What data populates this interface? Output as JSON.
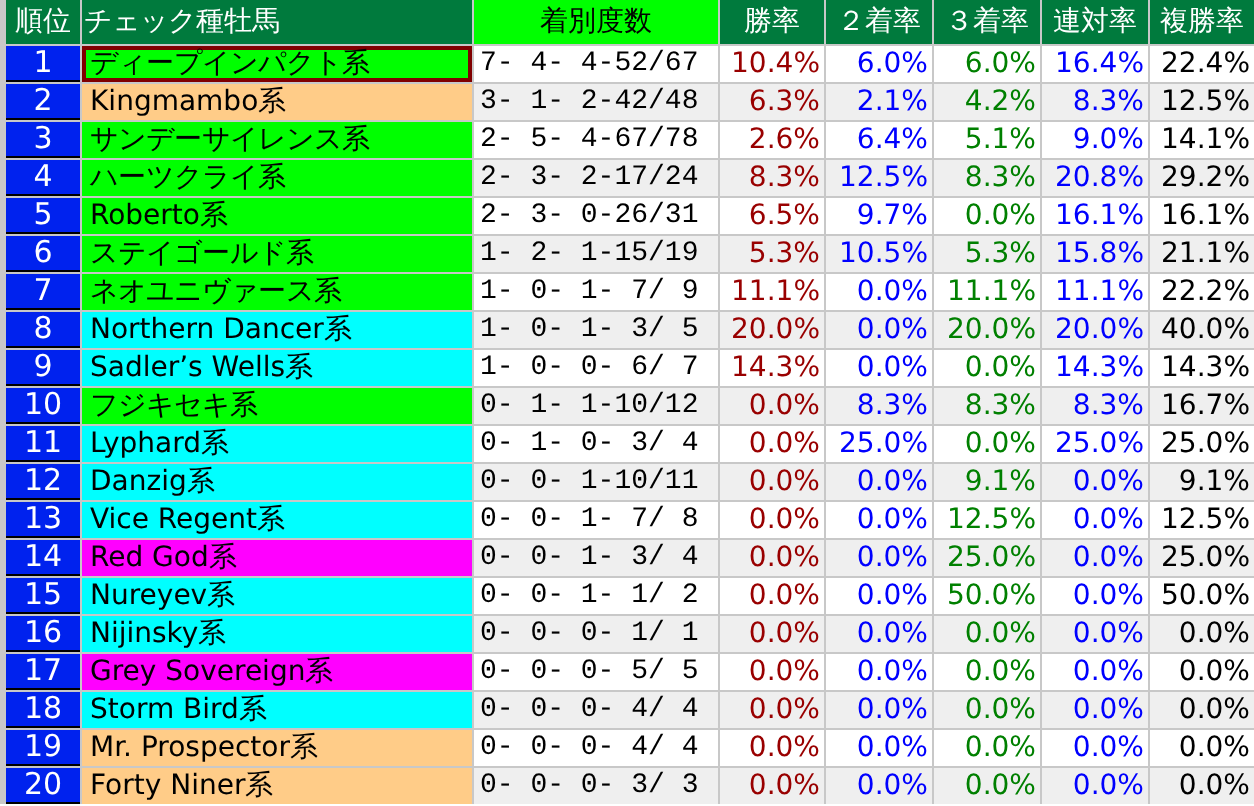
{
  "table": {
    "columns": [
      {
        "label": "順位",
        "selected": false
      },
      {
        "label": "チェック種牡馬",
        "selected": false
      },
      {
        "label": "着別度数",
        "selected": true
      },
      {
        "label": "勝率",
        "selected": false
      },
      {
        "label": "２着率",
        "selected": false
      },
      {
        "label": "３着率",
        "selected": false
      },
      {
        "label": "連対率",
        "selected": false
      },
      {
        "label": "複勝率",
        "selected": false
      }
    ],
    "rows": [
      {
        "rank": "1",
        "name": "ディープインパクト系",
        "color": "#00ff00",
        "selected": true,
        "record": "7- 4- 4-52/67",
        "rates": [
          "10.4%",
          "6.0%",
          "6.0%",
          "16.4%",
          "22.4%"
        ]
      },
      {
        "rank": "2",
        "name": "Kingmambo系",
        "color": "#ffcc88",
        "selected": false,
        "record": "3- 1- 2-42/48",
        "rates": [
          "6.3%",
          "2.1%",
          "4.2%",
          "8.3%",
          "12.5%"
        ]
      },
      {
        "rank": "3",
        "name": "サンデーサイレンス系",
        "color": "#00ff00",
        "selected": false,
        "record": "2- 5- 4-67/78",
        "rates": [
          "2.6%",
          "6.4%",
          "5.1%",
          "9.0%",
          "14.1%"
        ]
      },
      {
        "rank": "4",
        "name": "ハーツクライ系",
        "color": "#00ff00",
        "selected": false,
        "record": "2- 3- 2-17/24",
        "rates": [
          "8.3%",
          "12.5%",
          "8.3%",
          "20.8%",
          "29.2%"
        ]
      },
      {
        "rank": "5",
        "name": "Roberto系",
        "color": "#00ff00",
        "selected": false,
        "record": "2- 3- 0-26/31",
        "rates": [
          "6.5%",
          "9.7%",
          "0.0%",
          "16.1%",
          "16.1%"
        ]
      },
      {
        "rank": "6",
        "name": "ステイゴールド系",
        "color": "#00ff00",
        "selected": false,
        "record": "1- 2- 1-15/19",
        "rates": [
          "5.3%",
          "10.5%",
          "5.3%",
          "15.8%",
          "21.1%"
        ]
      },
      {
        "rank": "7",
        "name": "ネオユニヴァース系",
        "color": "#00ff00",
        "selected": false,
        "record": "1- 0- 1- 7/ 9",
        "rates": [
          "11.1%",
          "0.0%",
          "11.1%",
          "11.1%",
          "22.2%"
        ]
      },
      {
        "rank": "8",
        "name": "Northern Dancer系",
        "color": "#00ffff",
        "selected": false,
        "record": "1- 0- 1- 3/ 5",
        "rates": [
          "20.0%",
          "0.0%",
          "20.0%",
          "20.0%",
          "40.0%"
        ]
      },
      {
        "rank": "9",
        "name": "Sadler’s Wells系",
        "color": "#00ffff",
        "selected": false,
        "record": "1- 0- 0- 6/ 7",
        "rates": [
          "14.3%",
          "0.0%",
          "0.0%",
          "14.3%",
          "14.3%"
        ]
      },
      {
        "rank": "10",
        "name": "フジキセキ系",
        "color": "#00ff00",
        "selected": false,
        "record": "0- 1- 1-10/12",
        "rates": [
          "0.0%",
          "8.3%",
          "8.3%",
          "8.3%",
          "16.7%"
        ]
      },
      {
        "rank": "11",
        "name": "Lyphard系",
        "color": "#00ffff",
        "selected": false,
        "record": "0- 1- 0- 3/ 4",
        "rates": [
          "0.0%",
          "25.0%",
          "0.0%",
          "25.0%",
          "25.0%"
        ]
      },
      {
        "rank": "12",
        "name": "Danzig系",
        "color": "#00ffff",
        "selected": false,
        "record": "0- 0- 1-10/11",
        "rates": [
          "0.0%",
          "0.0%",
          "9.1%",
          "0.0%",
          "9.1%"
        ]
      },
      {
        "rank": "13",
        "name": "Vice Regent系",
        "color": "#00ffff",
        "selected": false,
        "record": "0- 0- 1- 7/ 8",
        "rates": [
          "0.0%",
          "0.0%",
          "12.5%",
          "0.0%",
          "12.5%"
        ]
      },
      {
        "rank": "14",
        "name": "Red God系",
        "color": "#ff00ff",
        "selected": false,
        "record": "0- 0- 1- 3/ 4",
        "rates": [
          "0.0%",
          "0.0%",
          "25.0%",
          "0.0%",
          "25.0%"
        ]
      },
      {
        "rank": "15",
        "name": "Nureyev系",
        "color": "#00ffff",
        "selected": false,
        "record": "0- 0- 1- 1/ 2",
        "rates": [
          "0.0%",
          "0.0%",
          "50.0%",
          "0.0%",
          "50.0%"
        ]
      },
      {
        "rank": "16",
        "name": "Nijinsky系",
        "color": "#00ffff",
        "selected": false,
        "record": "0- 0- 0- 1/ 1",
        "rates": [
          "0.0%",
          "0.0%",
          "0.0%",
          "0.0%",
          "0.0%"
        ]
      },
      {
        "rank": "17",
        "name": "Grey Sovereign系",
        "color": "#ff00ff",
        "selected": false,
        "record": "0- 0- 0- 5/ 5",
        "rates": [
          "0.0%",
          "0.0%",
          "0.0%",
          "0.0%",
          "0.0%"
        ]
      },
      {
        "rank": "18",
        "name": "Storm Bird系",
        "color": "#00ffff",
        "selected": false,
        "record": "0- 0- 0- 4/ 4",
        "rates": [
          "0.0%",
          "0.0%",
          "0.0%",
          "0.0%",
          "0.0%"
        ]
      },
      {
        "rank": "19",
        "name": "Mr. Prospector系",
        "color": "#ffcc88",
        "selected": false,
        "record": "0- 0- 0- 4/ 4",
        "rates": [
          "0.0%",
          "0.0%",
          "0.0%",
          "0.0%",
          "0.0%"
        ]
      },
      {
        "rank": "20",
        "name": "Forty Niner系",
        "color": "#ffcc88",
        "selected": false,
        "record": "0- 0- 0- 3/ 3",
        "rates": [
          "0.0%",
          "0.0%",
          "0.0%",
          "0.0%",
          "0.0%"
        ]
      }
    ]
  }
}
